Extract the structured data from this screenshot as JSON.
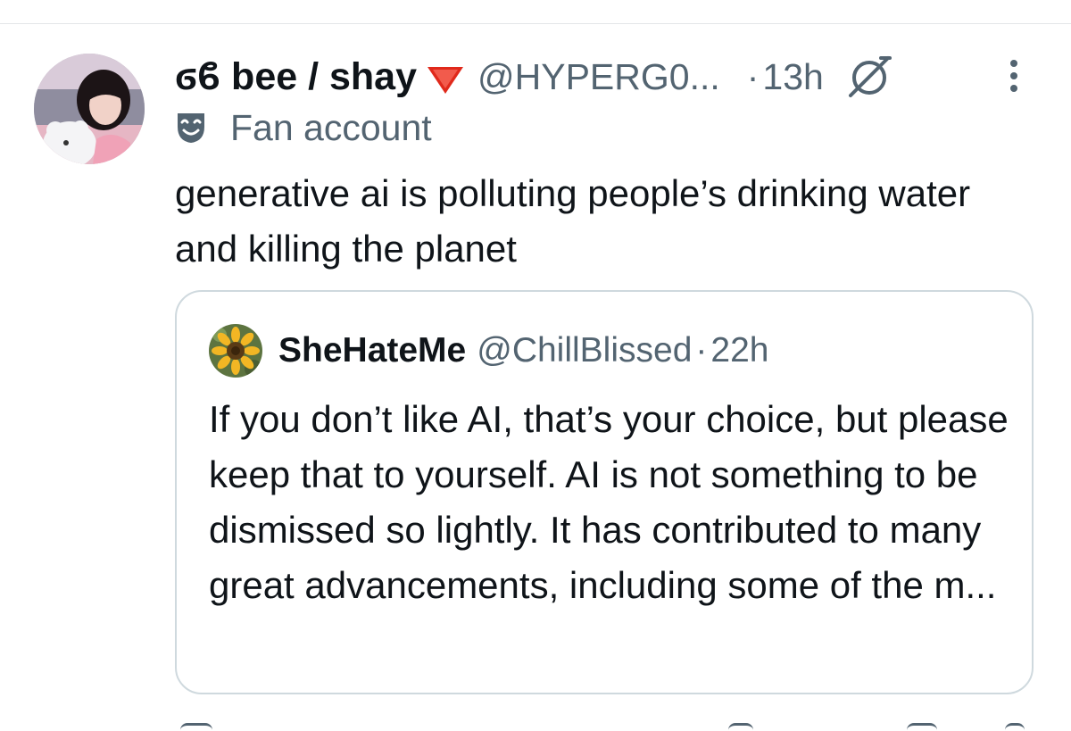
{
  "tweet": {
    "display_name": "ϭϐ bee / shay",
    "handle": "@HYPERG0...",
    "separator": "·",
    "timestamp": "13h",
    "label": "Fan account",
    "text": "generative ai is polluting people’s drinking water and killing the planet",
    "icons": {
      "name_emoji": "red-triangle-icon",
      "affiliation": "slashed-circle-icon",
      "label": "theater-mask-icon",
      "more": "more-options-icon"
    }
  },
  "quoted_tweet": {
    "display_name": "SheHateMe",
    "handle": "@ChillBlissed",
    "separator": "·",
    "timestamp": "22h",
    "text": "If you don’t like AI, that’s your choice, but please keep that to yourself. AI is not something to be dismissed so lightly. It has contributed to many great advancements, including some of the m...",
    "avatar": "sunflower-avatar"
  },
  "colors": {
    "text_primary": "#0f1419",
    "text_secondary": "#536471",
    "border": "#cfd9de",
    "red_triangle": "#e0291b"
  }
}
